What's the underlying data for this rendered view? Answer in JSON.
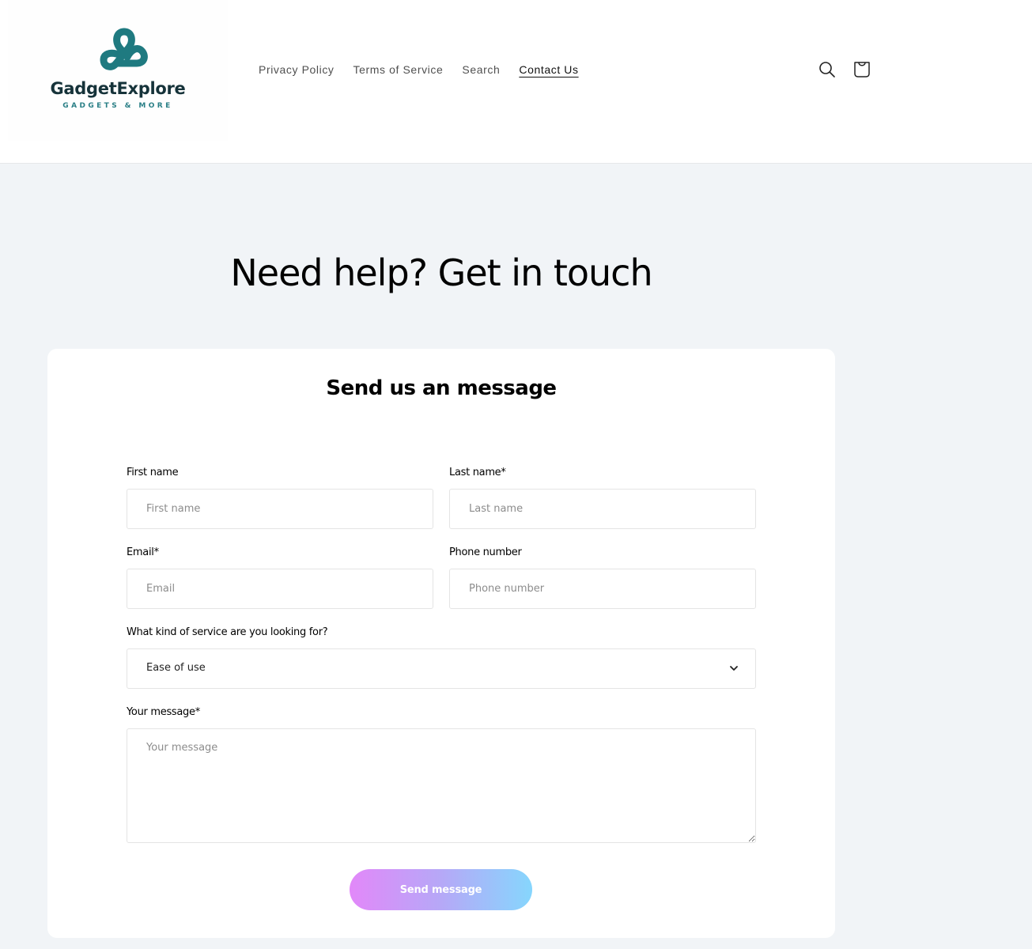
{
  "brand": {
    "name": "GadgetExplore",
    "tagline": "GADGETS & MORE",
    "primary_color": "#16333a",
    "accent_color": "#1f7a80"
  },
  "nav": {
    "items": [
      {
        "label": "Privacy Policy",
        "active": false
      },
      {
        "label": "Terms of Service",
        "active": false
      },
      {
        "label": "Search",
        "active": false
      },
      {
        "label": "Contact Us",
        "active": true
      }
    ]
  },
  "header_icons": {
    "search": "search-icon",
    "cart": "cart-icon"
  },
  "page": {
    "title": "Need help? Get in touch"
  },
  "form": {
    "title": "Send us an message",
    "first_name": {
      "label": "First name",
      "placeholder": "First name",
      "value": ""
    },
    "last_name": {
      "label": "Last name*",
      "placeholder": "Last name",
      "value": ""
    },
    "email": {
      "label": "Email*",
      "placeholder": "Email",
      "value": ""
    },
    "phone": {
      "label": "Phone number",
      "placeholder": "Phone number",
      "value": ""
    },
    "service": {
      "label": "What kind of service are you looking for?",
      "selected": "Ease of use"
    },
    "message": {
      "label": "Your message*",
      "placeholder": "Your message",
      "value": ""
    },
    "submit_label": "Send message",
    "submit_gradient": [
      "#e288f9",
      "#86d6fd"
    ]
  }
}
